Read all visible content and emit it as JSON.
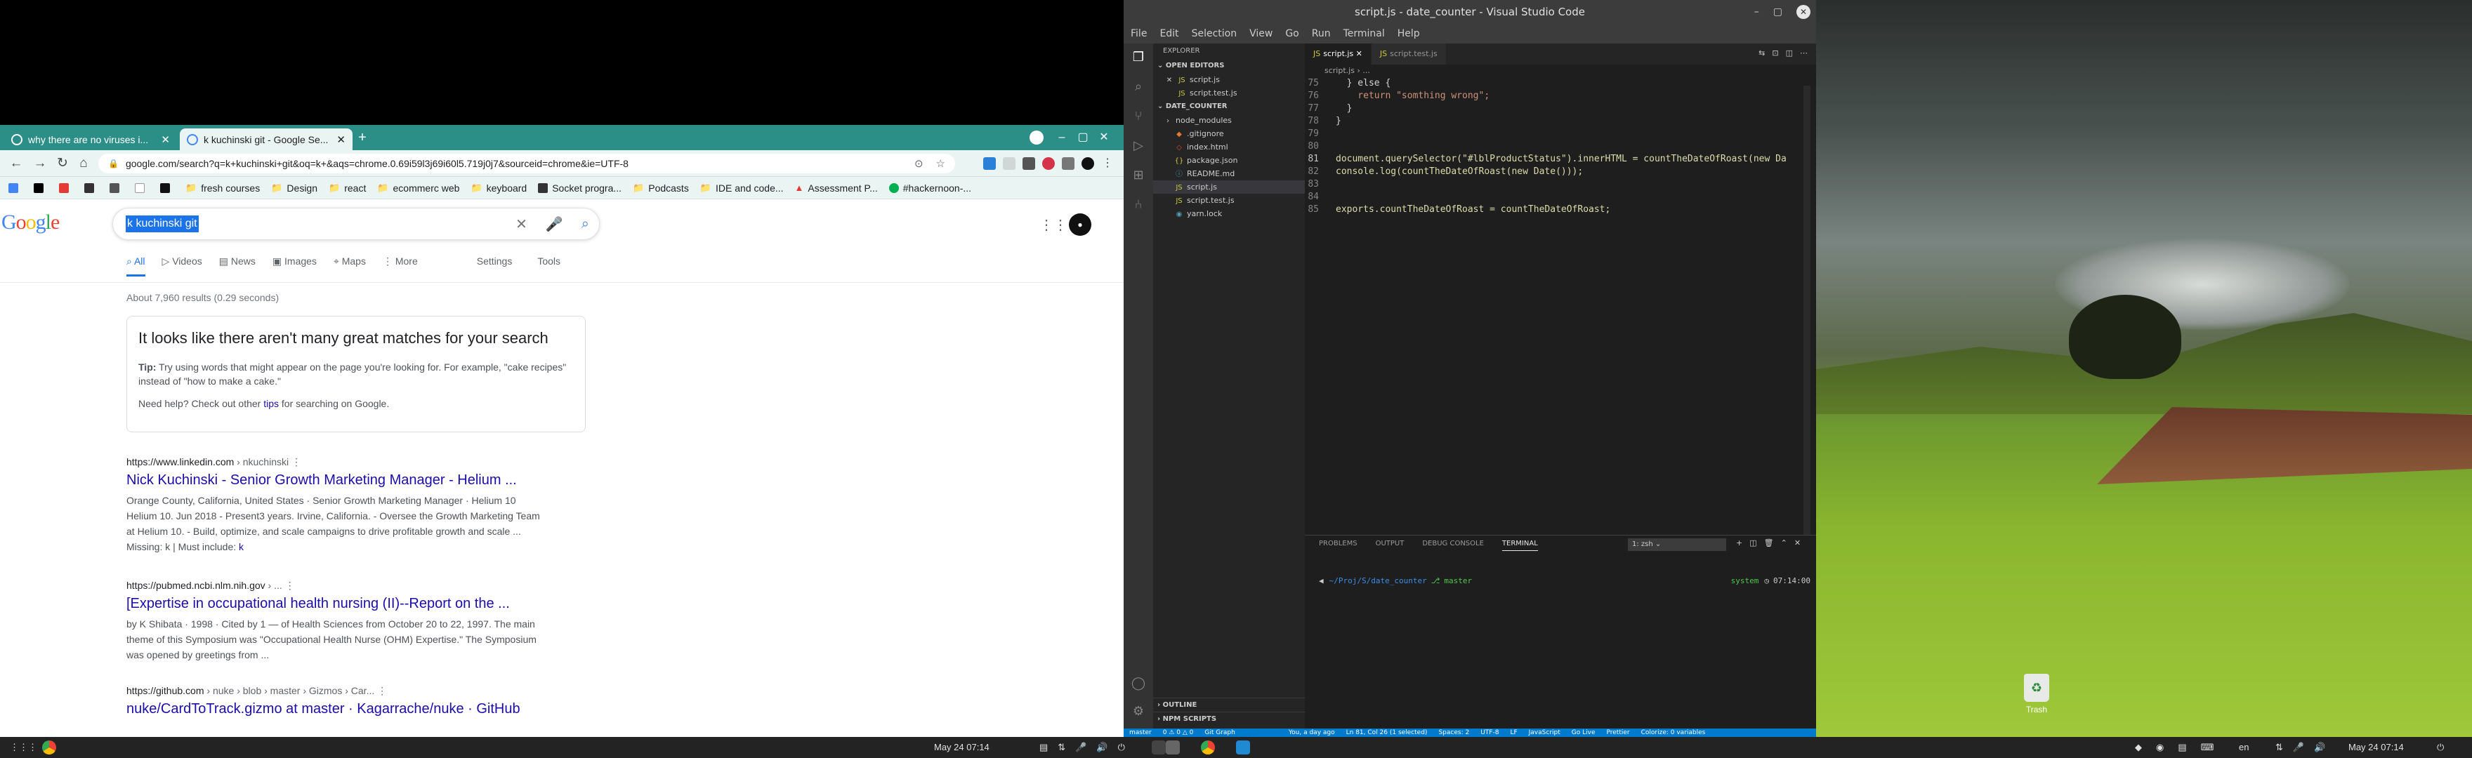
{
  "chrome": {
    "tabs": [
      {
        "title": "why there are no viruses i..."
      },
      {
        "title": "k kuchinski git - Google Se..."
      }
    ],
    "new_tab": "+",
    "url": "google.com/search?q=k+kuchinski+git&oq=k+&aqs=chrome.0.69i59l3j69i60l5.719j0j7&sourceid=chrome&ie=UTF-8",
    "bookmarks": [
      "fresh courses",
      "Design",
      "react",
      "ecommerc web",
      "keyboard",
      "Socket progra...",
      "Podcasts",
      "IDE and code...",
      "Assessment P...",
      "#hackernoon-..."
    ]
  },
  "google": {
    "logo": "Google",
    "query": "k kuchinski git",
    "tabs": [
      "All",
      "Videos",
      "News",
      "Images",
      "Maps",
      "More"
    ],
    "tools": [
      "Settings",
      "Tools"
    ],
    "stats": "About 7,960 results (0.29 seconds)",
    "card": {
      "heading": "It looks like there aren't many great matches for your search",
      "tip_label": "Tip:",
      "tip_text": " Try using words that might appear on the page you're looking for. For example, \"cake recipes\" instead of \"how to make a cake.\"",
      "help_before": "Need help? Check out other ",
      "help_link": "tips",
      "help_after": " for searching on Google."
    },
    "results": [
      {
        "url": "https://www.linkedin.com",
        "path": " › nkuchinski",
        "title": "Nick Kuchinski - Senior Growth Marketing Manager - Helium ...",
        "snippet1": "Orange County, California, United States · Senior Growth Marketing Manager · Helium 10",
        "snippet2": "Helium 10. Jun 2018 - Present3 years. Irvine, California. - Oversee the Growth Marketing Team",
        "snippet3": "at Helium 10. - Build, optimize, and scale campaigns to drive profitable growth and scale ...",
        "missing": "Missing: k | Must include: ",
        "missing_link": "k"
      },
      {
        "url": "https://pubmed.ncbi.nlm.nih.gov",
        "path": " › ...",
        "title": "[Expertise in occupational health nursing (II)--Report on the ...",
        "snippet1": "by K Shibata · 1998 · Cited by 1 — of Health Sciences from October 20 to 22, 1997. The main",
        "snippet2": "theme of this Symposium was \"Occupational Health Nurse (OHM) Expertise.\" The Symposium",
        "snippet3": "was opened by greetings from ..."
      },
      {
        "url": "https://github.com",
        "path": " › nuke › blob › master › Gizmos › Car...",
        "title": "nuke/CardToTrack.gizmo at master · Kagarrache/nuke · GitHub"
      }
    ]
  },
  "vscode": {
    "title": "script.js - date_counter - Visual Studio Code",
    "menu": [
      "File",
      "Edit",
      "Selection",
      "View",
      "Go",
      "Run",
      "Terminal",
      "Help"
    ],
    "explorer": {
      "header": "EXPLORER",
      "open_editors": "OPEN EDITORS",
      "open_files": [
        "script.js",
        "script.test.js"
      ],
      "project": "DATE_COUNTER",
      "files": [
        "node_modules",
        ".gitignore",
        "index.html",
        "package.json",
        "README.md",
        "script.js",
        "script.test.js",
        "yarn.lock"
      ],
      "outline": "OUTLINE",
      "npm": "NPM SCRIPTS"
    },
    "tabs": [
      "script.js",
      "script.test.js"
    ],
    "breadcrumb": "script.js › ...",
    "code": [
      {
        "n": "75",
        "t": "  } else {"
      },
      {
        "n": "76",
        "t": "    return \"somthing wrong\";"
      },
      {
        "n": "77",
        "t": "  }"
      },
      {
        "n": "78",
        "t": "}"
      },
      {
        "n": "79",
        "t": ""
      },
      {
        "n": "80",
        "t": ""
      },
      {
        "n": "81",
        "t": "document.querySelector(\"#lblProductStatus\").innerHTML = countTheDateOfRoast(new Da"
      },
      {
        "n": "82",
        "t": "console.log(countTheDateOfRoast(new Date()));"
      },
      {
        "n": "83",
        "t": ""
      },
      {
        "n": "84",
        "t": ""
      },
      {
        "n": "85",
        "t": "exports.countTheDateOfRoast = countTheDateOfRoast;"
      }
    ],
    "panel_tabs": [
      "PROBLEMS",
      "OUTPUT",
      "DEBUG CONSOLE",
      "TERMINAL"
    ],
    "shell": "1: zsh",
    "terminal": {
      "path": "~/Proj/S/date_counter",
      "branch": "master",
      "right": "system",
      "time": "07:14:00"
    },
    "status": [
      "master",
      "0 ⚠ 0 △ 0",
      "Git Graph",
      "You, a day ago",
      "Ln 81, Col 26 (1 selected)",
      "Spaces: 2",
      "UTF-8",
      "LF",
      "JavaScript",
      "Go Live",
      "Prettier",
      "Colorize: 0 variables"
    ]
  },
  "desktop": {
    "trash_label": "Trash"
  },
  "taskbar": {
    "left_clock": "May 24  07:14",
    "right_clock": "May 24  07:14",
    "lang": "en"
  }
}
